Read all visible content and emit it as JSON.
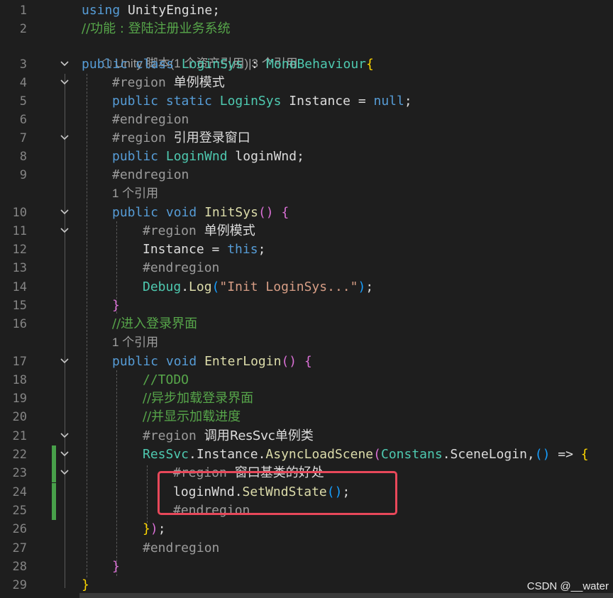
{
  "editor": {
    "line_numbers": [
      "1",
      "2",
      "3",
      "4",
      "5",
      "6",
      "7",
      "8",
      "9",
      "10",
      "11",
      "12",
      "13",
      "14",
      "15",
      "16",
      "17",
      "18",
      "19",
      "20",
      "21",
      "22",
      "23",
      "24",
      "25",
      "26",
      "27",
      "28",
      "29"
    ],
    "colors": {
      "background": "#1e1e1e",
      "keyword": "#569cd6",
      "type": "#4ec9b0",
      "method": "#dcdcaa",
      "string": "#d69d85",
      "comment": "#57a64a",
      "preprocessor": "#9b9b9b",
      "highlight_box": "#e8485a",
      "change_marker": "#48a04a"
    },
    "code": {
      "l1": {
        "kw": "using",
        "rest": " UnityEngine;"
      },
      "l2": {
        "comment": "//功能 : 登陆注册业务系统"
      },
      "lens_class": {
        "icon": "cube-icon",
        "text": "Unity 脚本(1 个资产引用)|3 个引用"
      },
      "l3": {
        "kw1": "public",
        "kw2": "class",
        "name": "LoginSys",
        "colon": " : ",
        "base": "MonoBehaviour",
        "brace": "{"
      },
      "l4": {
        "directive": "#region",
        "label": "单例模式"
      },
      "l5": {
        "kw1": "public",
        "kw2": "static",
        "type": "LoginSys",
        "field": " Instance = ",
        "val": "null",
        "semi": ";"
      },
      "l6": {
        "directive": "#endregion"
      },
      "l7": {
        "directive": "#region",
        "label": "引用登录窗口"
      },
      "l8": {
        "kw": "public",
        "type": "LoginWnd",
        "field": " loginWnd;"
      },
      "l9": {
        "directive": "#endregion"
      },
      "lens_init": {
        "text": "1 个引用"
      },
      "l10": {
        "kw1": "public",
        "kw2": "void",
        "fn": "InitSys",
        "paren": "()",
        "brace": "{"
      },
      "l11": {
        "directive": "#region",
        "label": "单例模式"
      },
      "l12": {
        "lhs": "Instance = ",
        "kw": "this",
        "semi": ";"
      },
      "l13": {
        "directive": "#endregion"
      },
      "l14": {
        "type": "Debug",
        "dot": ".",
        "fn": "Log",
        "open": "(",
        "str": "\"Init LoginSys...\"",
        "close": ")",
        "semi": ";"
      },
      "l15": {
        "brace": "}"
      },
      "l16": {
        "comment": "//进入登录界面"
      },
      "lens_enter": {
        "text": "1 个引用"
      },
      "l17": {
        "kw1": "public",
        "kw2": "void",
        "fn": "EnterLogin",
        "paren": "()",
        "brace": "{"
      },
      "l18": {
        "comment": "//TODO"
      },
      "l19": {
        "comment": "//异步加载登录界面"
      },
      "l20": {
        "comment": "//并显示加载进度"
      },
      "l21": {
        "directive": "#region",
        "label": "调用ResSvc单例类"
      },
      "l22": {
        "type1": "ResSvc",
        "dot1": ".",
        "prop": "Instance",
        "dot2": ".",
        "fn": "AsyncLoadScene",
        "open": "(",
        "type2": "Constans",
        "dot3": ".",
        "arg": "SceneLogin,",
        "lambda_paren": "()",
        "arrow": " => ",
        "brace": "{"
      },
      "l23": {
        "directive": "#region",
        "label": "窗口基类的好处"
      },
      "l24": {
        "obj": "loginWnd",
        "dot": ".",
        "fn": "SetWndState",
        "paren": "()",
        "semi": ";"
      },
      "l25": {
        "directive": "#endregion"
      },
      "l26": {
        "brace": "}",
        "close": ")",
        "semi": ";"
      },
      "l27": {
        "directive": "#endregion"
      },
      "l28": {
        "brace": "}"
      },
      "l29": {
        "brace": "}"
      }
    }
  },
  "watermark": "CSDN @__water"
}
